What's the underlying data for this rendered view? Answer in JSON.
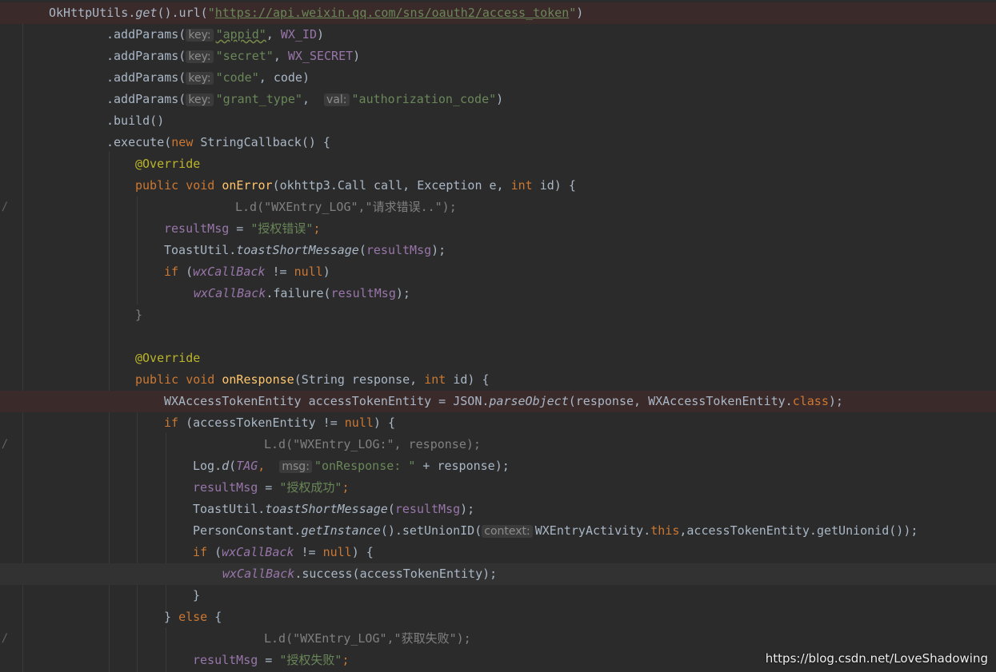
{
  "code": {
    "l1": {
      "recv": "OkHttpUtils",
      "dot": ".",
      "get": "get",
      "rest": "().url(",
      "q1": "\"",
      "url": "https://api.weixin.qq.com/sns/oauth2/access_token",
      "q2": "\"",
      "close": ")"
    },
    "l2": {
      "pre": ".addParams(",
      "hint": "key:",
      "str": "\"appid\"",
      "mid": ", ",
      "arg": "WX_ID",
      "close": ")"
    },
    "l3": {
      "pre": ".addParams(",
      "hint": "key:",
      "str": "\"secret\"",
      "mid": ", ",
      "arg": "WX_SECRET",
      "close": ")"
    },
    "l4": {
      "pre": ".addParams(",
      "hint": "key:",
      "str": "\"code\"",
      "mid": ", ",
      "arg": "code",
      "close": ")"
    },
    "l5": {
      "pre": ".addParams(",
      "hint": "key:",
      "str": "\"grant_type\"",
      "mid": ",  ",
      "hint2": "val:",
      "str2": "\"authorization_code\"",
      "close": ")"
    },
    "l6": {
      "text": ".build()"
    },
    "l7": {
      "pre": ".execute(",
      "kw": "new",
      "rest": " StringCallback() {"
    },
    "l8": {
      "ann": "@Override"
    },
    "l9": {
      "kw1": "public",
      "kw2": "void",
      "mname": "onError",
      "p1": "(okhttp3.Call call, Exception e, ",
      "kw3": "int",
      "p2": " id) {"
    },
    "l10": {
      "cmt": "L.d(\"WXEntry_LOG\",\"请求错误..\");"
    },
    "l11": {
      "fld": "resultMsg",
      "eq": " = ",
      "str": "\"授权错误\"",
      "semi": ";"
    },
    "l12": {
      "cls": "ToastUtil.",
      "fn": "toastShortMessage",
      "open": "(",
      "fld": "resultMsg",
      "close": ");"
    },
    "l13": {
      "kw": "if",
      "open": " (",
      "sfld": "wxCallBack",
      "ne": " != ",
      "kw2": "null",
      "close": ")"
    },
    "l14": {
      "sfld": "wxCallBack",
      "rest": ".failure(",
      "fld": "resultMsg",
      "close": ");"
    },
    "l15": {
      "text": "}"
    },
    "l16": {
      "ann": "@Override"
    },
    "l17": {
      "kw1": "public",
      "kw2": "void",
      "mname": "onResponse",
      "p1": "(String response, ",
      "kw3": "int",
      "p2": " id) {"
    },
    "l18": {
      "pre": "WXAccessTokenEntity accessTokenEntity = JSON.",
      "fn": "parseObject",
      "mid": "(response, WXAccessTokenEntity.",
      "kw": "class",
      "close": ");"
    },
    "l19": {
      "kw": "if",
      "rest": " (accessTokenEntity != ",
      "kw2": "null",
      "close": ") {"
    },
    "l20": {
      "cmt": "L.d(\"WXEntry_LOG:\", response);"
    },
    "l21": {
      "cls": "Log.",
      "fn": "d",
      "open": "(",
      "sfld": "TAG",
      "comma": ",  ",
      "hint": "msg:",
      "str": "\"onResponse: \"",
      "rest": " + response);"
    },
    "l22": {
      "fld": "resultMsg",
      "eq": " = ",
      "str": "\"授权成功\"",
      "semi": ";"
    },
    "l23": {
      "cls": "ToastUtil.",
      "fn": "toastShortMessage",
      "open": "(",
      "fld": "resultMsg",
      "close": ");"
    },
    "l24": {
      "cls": "PersonConstant.",
      "fn": "getInstance",
      "mid": "().setUnionID(",
      "hint": "context:",
      "arg": "WXEntryActivity.",
      "kw": "this",
      "rest": ",accessTokenEntity.getUnionid());"
    },
    "l25": {
      "kw": "if",
      "open": " (",
      "sfld": "wxCallBack",
      "ne": " != ",
      "kw2": "null",
      "close": ") {"
    },
    "l26": {
      "sfld": "wxCallBack",
      "rest": ".success(accessTokenEntity);"
    },
    "l27": {
      "text": "}"
    },
    "l28": {
      "b1": "} ",
      "kw": "else",
      "b2": " {"
    },
    "l29": {
      "cmt": "L.d(\"WXEntry_LOG\",\"获取失败\");"
    },
    "l30": {
      "fld": "resultMsg",
      "eq": " = ",
      "str": "\"授权失败\"",
      "semi": ";"
    }
  },
  "gutter": {
    "mark": "/"
  },
  "watermark": "https://blog.csdn.net/LoveShadowing"
}
